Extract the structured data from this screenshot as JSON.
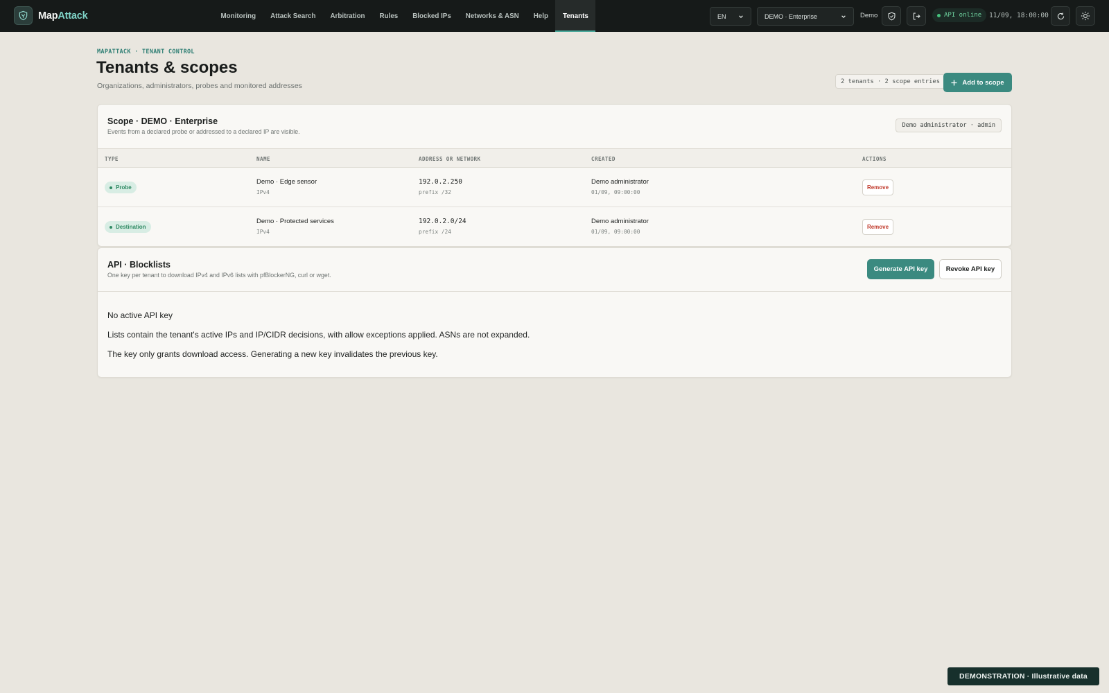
{
  "app": {
    "name_prefix": "Map",
    "name_accent": "Attack"
  },
  "nav": {
    "items": [
      {
        "label": "Monitoring"
      },
      {
        "label": "Attack Search"
      },
      {
        "label": "Arbitration"
      },
      {
        "label": "Rules"
      },
      {
        "label": "Blocked IPs"
      },
      {
        "label": "Networks & ASN"
      },
      {
        "label": "Help"
      },
      {
        "label": "Tenants",
        "active": true
      }
    ]
  },
  "topbar": {
    "language": "EN",
    "tenant_select": "DEMO · Enterprise",
    "user": "Demo",
    "api_status": "API online",
    "datetime": "11/09, 18:00:00"
  },
  "header": {
    "breadcrumb": "MAPATTACK · TENANT CONTROL",
    "title": "Tenants & scopes",
    "subtitle": "Organizations, administrators, probes and monitored addresses",
    "counts": "2 tenants · 2 scope entries",
    "add_button": "Add to scope"
  },
  "scope_panel": {
    "title": "Scope · DEMO · Enterprise",
    "description": "Events from a declared probe or addressed to a declared IP are visible.",
    "admin_badge": "Demo administrator · admin",
    "columns": {
      "type": "TYPE",
      "name": "NAME",
      "address": "ADDRESS OR NETWORK",
      "created": "CREATED",
      "actions": "ACTIONS"
    },
    "rows": [
      {
        "type": "Probe",
        "name": "Demo · Edge sensor",
        "family": "IPv4",
        "address": "192.0.2.250",
        "prefix": "prefix /32",
        "created_by": "Demo administrator",
        "created_at": "01/09, 09:00:00",
        "action": "Remove"
      },
      {
        "type": "Destination",
        "name": "Demo · Protected services",
        "family": "IPv4",
        "address": "192.0.2.0/24",
        "prefix": "prefix /24",
        "created_by": "Demo administrator",
        "created_at": "01/09, 09:00:00",
        "action": "Remove"
      }
    ]
  },
  "api_panel": {
    "title": "API · Blocklists",
    "description": "One key per tenant to download IPv4 and IPv6 lists with pfBlockerNG, curl or wget.",
    "generate_button": "Generate API key",
    "revoke_button": "Revoke API key",
    "status": "No active API key",
    "info_1": "Lists contain the tenant's active IPs and IP/CIDR decisions, with allow exceptions applied. ASNs are not expanded.",
    "info_2": "The key only grants download access. Generating a new key invalidates the previous key."
  },
  "footer": {
    "demo_banner": "DEMONSTRATION · Illustrative data"
  },
  "colors": {
    "accent": "#3b8a80",
    "topbar": "#161a19",
    "background": "#e9e6df",
    "badge_green": "#2f8a63",
    "danger": "#c0392b"
  },
  "icons": {
    "logo": "shield-logo-icon",
    "shield": "shield-check-icon",
    "logout": "logout-icon",
    "refresh": "refresh-icon",
    "theme": "sun-icon",
    "add": "plus-icon",
    "dropdown": "chevron-down-icon"
  }
}
